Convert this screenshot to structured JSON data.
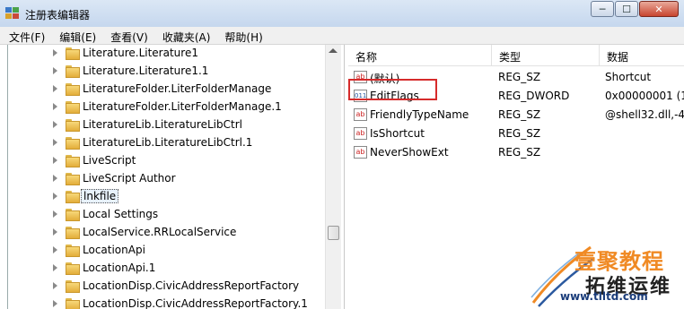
{
  "window": {
    "title": "注册表编辑器",
    "min_label": "─",
    "max_label": "☐",
    "close_label": "✕"
  },
  "menu": [
    "文件(F)",
    "编辑(E)",
    "查看(V)",
    "收藏夹(A)",
    "帮助(H)"
  ],
  "tree": {
    "items": [
      {
        "label": "Literature.Literature1",
        "selected": false
      },
      {
        "label": "Literature.Literature1.1",
        "selected": false
      },
      {
        "label": "LiteratureFolder.LiterFolderManage",
        "selected": false
      },
      {
        "label": "LiteratureFolder.LiterFolderManage.1",
        "selected": false
      },
      {
        "label": "LiteratureLib.LiteratureLibCtrl",
        "selected": false
      },
      {
        "label": "LiteratureLib.LiteratureLibCtrl.1",
        "selected": false
      },
      {
        "label": "LiveScript",
        "selected": false
      },
      {
        "label": "LiveScript Author",
        "selected": false
      },
      {
        "label": "lnkfile",
        "selected": true
      },
      {
        "label": "Local Settings",
        "selected": false
      },
      {
        "label": "LocalService.RRLocalService",
        "selected": false
      },
      {
        "label": "LocationApi",
        "selected": false
      },
      {
        "label": "LocationApi.1",
        "selected": false
      },
      {
        "label": "LocationDisp.CivicAddressReportFactory",
        "selected": false
      },
      {
        "label": "LocationDisp.CivicAddressReportFactory.1",
        "selected": false
      }
    ]
  },
  "values": {
    "headers": {
      "name": "名称",
      "type": "类型",
      "data": "数据"
    },
    "rows": [
      {
        "icon": "string-value-icon",
        "glyph": "ab",
        "name": "(默认)",
        "type": "REG_SZ",
        "data": "Shortcut"
      },
      {
        "icon": "binary-value-icon",
        "glyph": "011",
        "name": "EditFlags",
        "type": "REG_DWORD",
        "data": "0x00000001 (1"
      },
      {
        "icon": "string-value-icon",
        "glyph": "ab",
        "name": "FriendlyTypeName",
        "type": "REG_SZ",
        "data": "@shell32.dll,-4"
      },
      {
        "icon": "string-value-icon",
        "glyph": "ab",
        "name": "IsShortcut",
        "type": "REG_SZ",
        "data": ""
      },
      {
        "icon": "string-value-icon",
        "glyph": "ab",
        "name": "NeverShowExt",
        "type": "REG_SZ",
        "data": ""
      }
    ]
  },
  "watermark": {
    "line1": "壹聚教程",
    "line2": "拓维运维",
    "line3": "www.tlltd.com"
  },
  "colors": {
    "highlight": "#d62b2b",
    "watermark_orange": "#f08a24"
  }
}
